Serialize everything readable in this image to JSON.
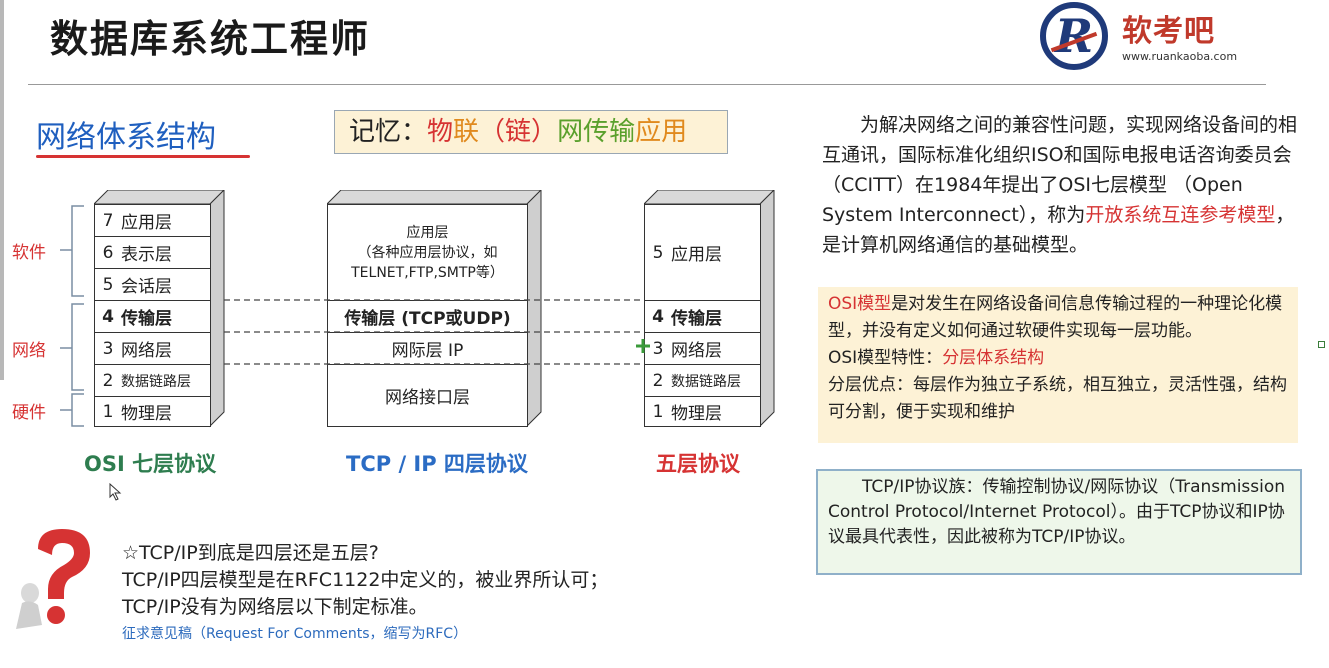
{
  "header": {
    "title": "数据库系统工程师",
    "logo_text": "软考吧",
    "logo_url": "www.ruankaoba.com"
  },
  "section": {
    "title": "网络体系结构"
  },
  "memory": {
    "prefix": "记忆：",
    "p1": "物",
    "p2": "联",
    "p3": "（链）",
    "p4": "网",
    "p5": "传输",
    "p6": "应用"
  },
  "side_labels": {
    "software": "软件",
    "network": "网络",
    "hardware": "硬件"
  },
  "osi": {
    "caption": "OSI 七层协议",
    "layers": [
      {
        "num": "7",
        "name": "应用层"
      },
      {
        "num": "6",
        "name": "表示层"
      },
      {
        "num": "5",
        "name": "会话层"
      },
      {
        "num": "4",
        "name": "传输层"
      },
      {
        "num": "3",
        "name": "网络层"
      },
      {
        "num": "2",
        "name": "数据链路层"
      },
      {
        "num": "1",
        "name": "物理层"
      }
    ]
  },
  "tcpip": {
    "caption": "TCP / IP 四层协议",
    "app_line1": "应用层",
    "app_line2": "（各种应用层协议，如",
    "app_line3": "TELNET,FTP,SMTP等）",
    "transport": "传输层 (TCP或UDP)",
    "internet": "网际层 IP",
    "netif": "网络接口层"
  },
  "five": {
    "caption": "五层协议",
    "layers": [
      {
        "num": "5",
        "name": "应用层"
      },
      {
        "num": "4",
        "name": "传输层"
      },
      {
        "num": "3",
        "name": "网络层"
      },
      {
        "num": "2",
        "name": "数据链路层"
      },
      {
        "num": "1",
        "name": "物理层"
      }
    ]
  },
  "intro": {
    "part1": "为解决网络之间的兼容性问题，实现网络设备间的相互通讯，国际标准化组织ISO和国际电报电话咨询委员会（CCITT）在1984年提出了OSI七层模型 （Open System Interconnect），称为",
    "highlight": "开放系统互连参考模型",
    "part2": "，是计算机网络通信的基础模型。"
  },
  "osi_box": {
    "term": "OSI模型",
    "line1": "是对发生在网络设备间信息传输过程的一种理论化模型，并没有定义如何通过软硬件实现每一层功能。",
    "feature_label": "OSI模型特性：",
    "feature_value": "分层体系结构",
    "advantage": "分层优点：每层作为独立子系统，相互独立，灵活性强，结构可分割，便于实现和维护"
  },
  "tcp_box": {
    "text": "TCP/IP协议族：传输控制协议/网际协议（Transmission Control Protocol/Internet Protocol）。由于TCP协议和IP协议最具代表性，因此被称为TCP/IP协议。"
  },
  "qa": {
    "question": "☆TCP/IP到底是四层还是五层?",
    "answer1": "TCP/IP四层模型是在RFC1122中定义的，被业界所认可；",
    "answer2": "TCP/IP没有为网络层以下制定标准。",
    "note": "征求意见稿（Request For Comments，缩写为RFC）"
  },
  "colors": {
    "title_blue": "#1f5fbf",
    "accent_red": "#d63333",
    "osi_green": "#2e7d4f",
    "tcp_blue": "#2b6cc4",
    "five_red": "#d63333",
    "memory_green": "#5aa02c",
    "memory_orange": "#e08a1e"
  }
}
